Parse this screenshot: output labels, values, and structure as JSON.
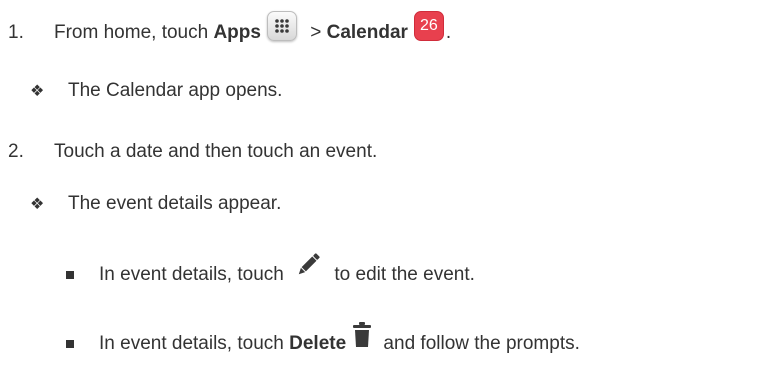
{
  "steps": [
    {
      "number": "1.",
      "prefix": "From home, touch ",
      "apps_label": "Apps",
      "separator": " > ",
      "calendar_label": "Calendar",
      "calendar_icon_text": "26",
      "suffix": ".",
      "result": "The Calendar app opens."
    },
    {
      "number": "2.",
      "text": "Touch a date and then touch an event.",
      "result": "The event details appear.",
      "subitems": [
        {
          "prefix": "In event details, touch ",
          "suffix": " to edit the event.",
          "icon": "pencil-icon"
        },
        {
          "prefix": "In event details, touch ",
          "bold": "Delete",
          "suffix": " and follow the prompts.",
          "icon": "trash-icon"
        }
      ]
    }
  ],
  "colors": {
    "text": "#333333",
    "calendar_icon": "#e8404e",
    "icon_dark": "#3a3a3a"
  }
}
